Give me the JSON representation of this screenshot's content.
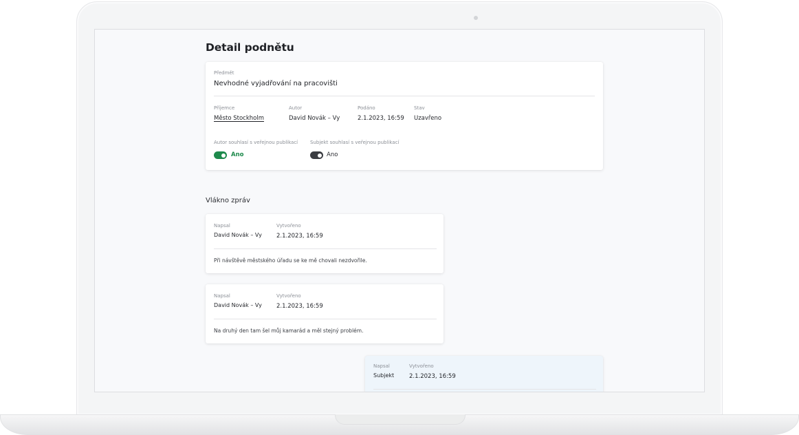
{
  "page": {
    "title": "Detail podnětu"
  },
  "detail": {
    "subject_label": "Předmět",
    "subject": "Nevhodné vyjadřování na pracovišti",
    "recipient_label": "Příjemce",
    "recipient": "Město Stockholm",
    "author_label": "Autor",
    "author": "David Novák – Vy",
    "submitted_label": "Podáno",
    "submitted": "2.1.2023, 16:59",
    "status_label": "Stav",
    "status": "Uzavřeno",
    "author_consent_label": "Autor souhlasí s veřejnou publikací",
    "author_consent_value": "Ano",
    "subject_consent_label": "Subjekt souhlasí s veřejnou publikací",
    "subject_consent_value": "Ano"
  },
  "thread": {
    "title": "Vlákno zpráv",
    "messages": [
      {
        "written_by_label": "Napsal",
        "written_by": "David Novák – Vy",
        "created_label": "Vytvořeno",
        "created": "2.1.2023, 16:59",
        "text": "Při návštěvě městského úřadu se ke mě chovali nezdvořile."
      },
      {
        "written_by_label": "Napsal",
        "written_by": "David Novák – Vy",
        "created_label": "Vytvořeno",
        "created": "2.1.2023, 16:59",
        "text": "Na druhý den tam šel můj kamarád a měl stejný problém."
      },
      {
        "written_by_label": "Napsal",
        "written_by": "Subjekt",
        "created_label": "Vytvořeno",
        "created": "2.1.2023, 16:59"
      }
    ]
  },
  "colors": {
    "toggle_on": "#1e8a4c",
    "toggle_on_text": "#1e8a4c",
    "toggle_dark": "#3b3d42",
    "subject_message_bg": "#eef5fb"
  },
  "icons": {
    "camera": "camera-dot-icon"
  }
}
